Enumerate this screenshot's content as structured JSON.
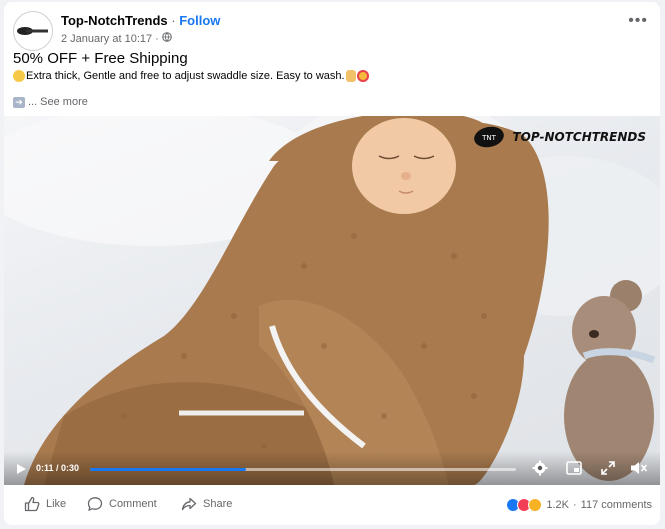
{
  "post": {
    "author": "Top-NotchTrends",
    "separator": "·",
    "follow_label": "Follow",
    "timestamp": "2 January at 10:17",
    "meta_dot": "·",
    "headline": "50% OFF + Free Shipping",
    "body": "Extra thick, Gentle and free to adjust swaddle size. Easy to wash.",
    "see_more_prefix": "...",
    "see_more": "See more"
  },
  "video": {
    "watermark": "TOP-NOTCHTRENDS",
    "watermark_badge": "TNT",
    "time": "0:11 / 0:30",
    "progress": 0.367
  },
  "footer": {
    "like_label": "Like",
    "comment_label": "Comment",
    "share_label": "Share",
    "reaction_count": "1.2K",
    "comments_count": "117 comments",
    "reaction_sep": "·"
  },
  "colors": {
    "accent": "#1877f2",
    "secondary_text": "#65676b",
    "fleece": "#a87a4e",
    "like_blue": "#1877f2",
    "love_red": "#f33e58",
    "care_yellow": "#f7b125"
  },
  "icons": [
    "more-icon",
    "globe-icon",
    "play-icon",
    "settings-icon",
    "mini-player-icon",
    "fullscreen-icon",
    "mute-icon",
    "like-icon",
    "comment-icon",
    "share-icon"
  ]
}
